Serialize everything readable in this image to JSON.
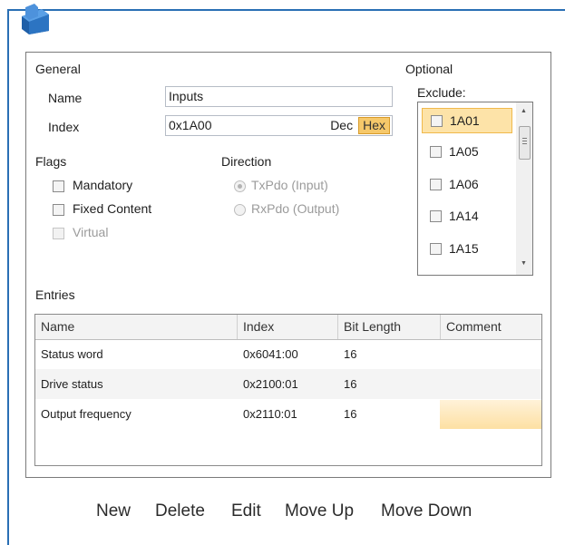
{
  "general": {
    "section_label": "General",
    "name_label": "Name",
    "name_value": "Inputs",
    "index_label": "Index",
    "index_value": "0x1A00",
    "dec_label": "Dec",
    "hex_label": "Hex"
  },
  "flags": {
    "section_label": "Flags",
    "mandatory": "Mandatory",
    "fixed_content": "Fixed Content",
    "virtual": "Virtual"
  },
  "direction": {
    "section_label": "Direction",
    "tx": "TxPdo (Input)",
    "rx": "RxPdo (Output)"
  },
  "optional": {
    "section_label": "Optional",
    "exclude_label": "Exclude:",
    "items": [
      "1A01",
      "1A05",
      "1A06",
      "1A14",
      "1A15"
    ]
  },
  "entries": {
    "section_label": "Entries",
    "columns": [
      "Name",
      "Index",
      "Bit Length",
      "Comment"
    ],
    "rows": [
      {
        "name": "Status word",
        "index": "0x6041:00",
        "bitlen": "16",
        "comment": ""
      },
      {
        "name": "Drive status",
        "index": "0x2100:01",
        "bitlen": "16",
        "comment": ""
      },
      {
        "name": "Output frequency",
        "index": "0x2110:01",
        "bitlen": "16",
        "comment": ""
      }
    ]
  },
  "footer": {
    "new": "New",
    "delete": "Delete",
    "edit": "Edit",
    "move_up": "Move Up",
    "move_down": "Move Down"
  },
  "colors": {
    "frame_blue": "#2a6fb4",
    "hex_highlight": "#f6c86a",
    "selected_item": "#fde3a8"
  },
  "icons": {
    "logo": "app-logo-icon",
    "scroll_up": "chevron-up-icon",
    "scroll_down": "chevron-down-icon"
  }
}
